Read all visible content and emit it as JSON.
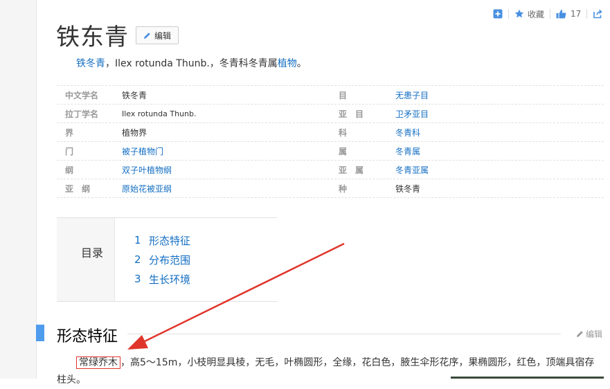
{
  "toolbar": {
    "collect_label": "收藏",
    "like_count": "17"
  },
  "title": "铁东青",
  "edit_label": "编辑",
  "summary": {
    "link1": "铁冬青",
    "middle": "，Ilex rotunda Thunb.，冬青科冬青属",
    "link2": "植物",
    "end": "。"
  },
  "infobox": {
    "left": [
      {
        "name": "中文学名",
        "value": "铁冬青"
      },
      {
        "name": "拉丁学名",
        "value": "Ilex rotunda Thunb."
      },
      {
        "name": "界",
        "value": "植物界"
      },
      {
        "name": "门",
        "value": "被子植物门"
      },
      {
        "name": "纲",
        "value": "双子叶植物纲"
      },
      {
        "name": "亚　纲",
        "value": "原始花被亚纲"
      }
    ],
    "right": [
      {
        "name": "目",
        "value": "无患子目"
      },
      {
        "name": "亚　目",
        "value": "卫矛亚目"
      },
      {
        "name": "科",
        "value": "冬青科"
      },
      {
        "name": "属",
        "value": "冬青属"
      },
      {
        "name": "亚　属",
        "value": "冬青亚属"
      },
      {
        "name": "种",
        "value": "铁冬青"
      }
    ]
  },
  "toc": {
    "label": "目录",
    "items": [
      {
        "num": "1",
        "text": "形态特征"
      },
      {
        "num": "2",
        "text": "分布范围"
      },
      {
        "num": "3",
        "text": "生长环境"
      }
    ]
  },
  "section": {
    "title": "形态特征",
    "edit_label": "编辑",
    "highlight": "常绿乔木",
    "text": "，高5～15m，小枝明显具棱，无毛，叶椭圆形，全缘，花白色，腋生伞形花序，果椭圆形，红色，顶端具宿存柱头。"
  },
  "colors": {
    "link": "#136ec2",
    "accent": "#4f9cee",
    "annotation": "#e0352b"
  }
}
